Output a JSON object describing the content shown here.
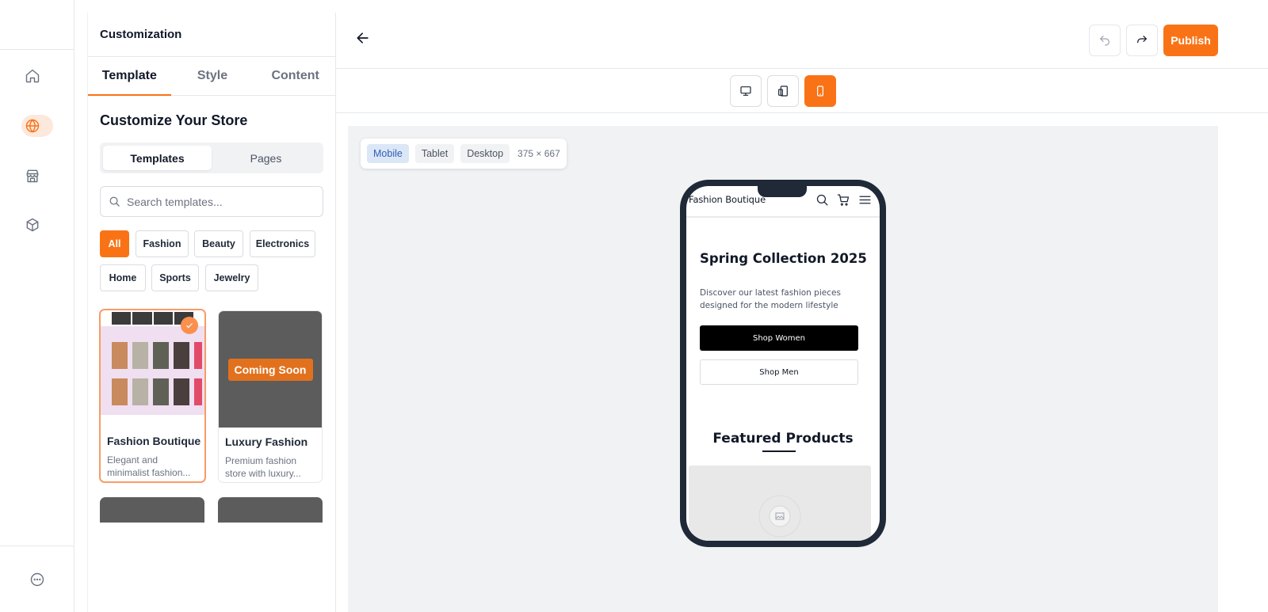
{
  "sidebar_rail": {
    "items": [
      {
        "icon": "home-icon",
        "active": false
      },
      {
        "icon": "globe-icon",
        "active": true
      },
      {
        "icon": "store-icon",
        "active": false
      },
      {
        "icon": "package-icon",
        "active": false
      }
    ],
    "bottom_icon": "more-icon"
  },
  "panel": {
    "title": "Customization",
    "tabs": [
      {
        "label": "Template",
        "active": true
      },
      {
        "label": "Style",
        "active": false
      },
      {
        "label": "Content",
        "active": false
      }
    ],
    "heading": "Customize Your Store",
    "segments": [
      {
        "label": "Templates",
        "active": true
      },
      {
        "label": "Pages",
        "active": false
      }
    ],
    "search": {
      "placeholder": "Search templates...",
      "value": ""
    },
    "categories": [
      {
        "label": "All",
        "active": true
      },
      {
        "label": "Fashion",
        "active": false
      },
      {
        "label": "Beauty",
        "active": false
      },
      {
        "label": "Electronics",
        "active": false
      },
      {
        "label": "Home",
        "active": false
      },
      {
        "label": "Sports",
        "active": false
      },
      {
        "label": "Jewelry",
        "active": false
      }
    ],
    "templates": [
      {
        "name": "Fashion Boutique",
        "desc": "Elegant and minimalist fashion...",
        "selected": true
      },
      {
        "name": "Luxury Fashion",
        "desc": "Premium fashion store with luxury...",
        "badge": "Coming Soon",
        "selected": false
      }
    ]
  },
  "header": {
    "back_icon": "arrow-left-icon",
    "undo_icon": "undo-icon",
    "redo_icon": "redo-icon",
    "publish_label": "Publish",
    "accent_color": "#f97316"
  },
  "device_toggle": {
    "options": [
      {
        "icon": "desktop-icon",
        "active": false
      },
      {
        "icon": "tablet-icon",
        "active": false
      },
      {
        "icon": "mobile-icon",
        "active": true
      }
    ]
  },
  "preview": {
    "viewport_options": [
      {
        "label": "Mobile",
        "active": true
      },
      {
        "label": "Tablet",
        "active": false
      },
      {
        "label": "Desktop",
        "active": false
      }
    ],
    "viewport_size": "375 × 667",
    "site": {
      "brand": "Fashion Boutique",
      "hero_title": "Spring Collection 2025",
      "hero_subtitle": "Discover our latest fashion pieces designed for the modern lifestyle",
      "primary_cta": "Shop Women",
      "secondary_cta": "Shop Men",
      "featured_heading": "Featured Products"
    }
  }
}
